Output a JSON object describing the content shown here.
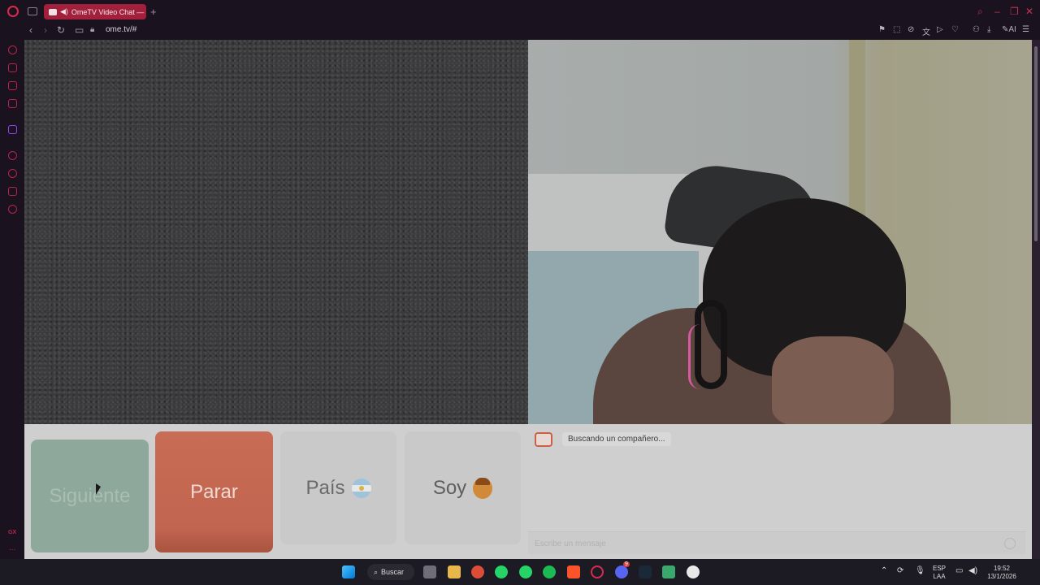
{
  "browser": {
    "tab_title": "OmeTV Video Chat — ",
    "new_tab_symbol": "+",
    "url": "ome.tv/#",
    "ai_label": "AI"
  },
  "sidebar": {
    "gx_label": "GX",
    "more_label": "..."
  },
  "controls": {
    "next_label": "Siguiente",
    "stop_label": "Parar",
    "country_label": "País",
    "iam_label": "Soy"
  },
  "chat": {
    "status_message": "Buscando un compañero...",
    "input_placeholder": "Escribe un mensaje"
  },
  "taskbar": {
    "search_label": "Buscar",
    "language_primary": "ESP",
    "language_secondary": "LAA",
    "time": "19:52",
    "date": "13/1/2026",
    "notification_badge": "9"
  }
}
